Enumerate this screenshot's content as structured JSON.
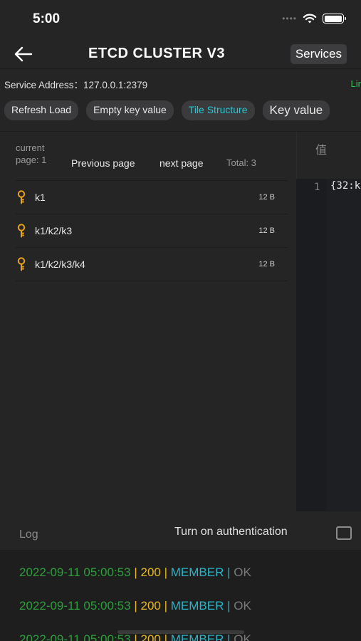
{
  "status_bar": {
    "time": "5:00",
    "dots": "••••"
  },
  "nav": {
    "title": "ETCD CLUSTER V3",
    "services_label": "Services"
  },
  "address": {
    "label": "Service Address：",
    "value": "127.0.0.1:2379",
    "link_partial": "Lir"
  },
  "buttons": {
    "refresh": "Refresh Load",
    "empty": "Empty key value",
    "tile": "Tile Structure",
    "keyvalue": "Key value"
  },
  "pager": {
    "current": "current page:  1",
    "prev": "Previous page",
    "next": "next page",
    "total": "Total:  3"
  },
  "keys": [
    {
      "name": "k1",
      "size": "12 B"
    },
    {
      "name": "k1/k2/k3",
      "size": "12 B"
    },
    {
      "name": "k1/k2/k3/k4",
      "size": "12 B"
    }
  ],
  "editor": {
    "header": "值",
    "line_number": "1",
    "line_text": "{32:k"
  },
  "log": {
    "label": "Log",
    "auth_label": "Turn on authentication",
    "entries": [
      {
        "time": "2022-09-11 05:00:53",
        "code": "200",
        "type": "MEMBER",
        "status": "OK"
      },
      {
        "time": "2022-09-11 05:00:53",
        "code": "200",
        "type": "MEMBER",
        "status": "OK"
      },
      {
        "time": "2022-09-11 05:00:53",
        "code": "200",
        "type": "MEMBER",
        "status": "OK"
      }
    ]
  },
  "colors": {
    "accent_cyan": "#27c7d3",
    "log_green": "#2e9e3c",
    "log_yellow": "#e8b923",
    "log_cyan": "#27b6c9",
    "key_icon": "#e8a21b",
    "link_green": "#2bbf4a"
  }
}
